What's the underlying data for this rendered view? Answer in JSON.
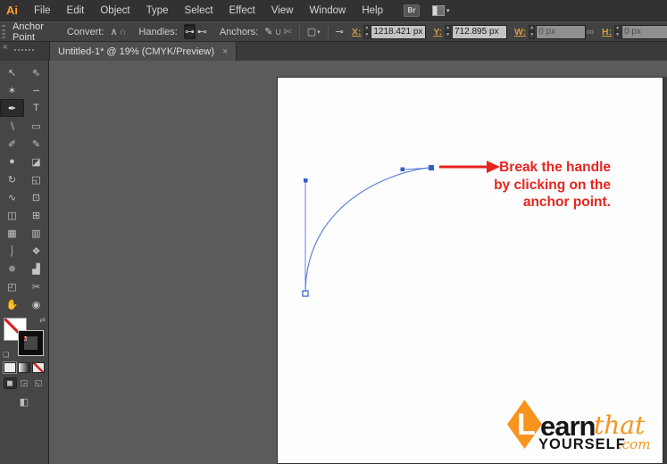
{
  "menubar": {
    "app_logo": "Ai",
    "items": [
      "File",
      "Edit",
      "Object",
      "Type",
      "Select",
      "Effect",
      "View",
      "Window",
      "Help"
    ],
    "bridge_icon": "Br",
    "workspace_caret": "▾"
  },
  "control_bar": {
    "context_label": "Anchor Point",
    "convert": {
      "label": "Convert:",
      "corner_icon": "∧",
      "smooth_icon": "∩"
    },
    "handles": {
      "label": "Handles:",
      "show_icon": "⊶",
      "hide_icon": "⊷"
    },
    "anchors": {
      "label": "Anchors:",
      "remove_icon": "✎",
      "connect_icon": "∪",
      "cut_icon": "✄"
    },
    "marquee_icon": "▢",
    "marquee_caret": "▾",
    "isolate_icon": "⊸",
    "x": {
      "label": "X:",
      "value": "1218.421 px"
    },
    "y": {
      "label": "Y:",
      "value": "712.895 px"
    },
    "w": {
      "label": "W:",
      "value": "0 px"
    },
    "h": {
      "label": "H:",
      "value": "0 px"
    },
    "link_icon": "∞",
    "transform_icon": "⊞",
    "stepper_up": "▲",
    "stepper_down": "▼"
  },
  "tab": {
    "title": "Untitled-1* @ 19% (CMYK/Preview)",
    "close": "×",
    "collapse": "«"
  },
  "toolbar": {
    "tools": [
      {
        "name": "selection",
        "glyph": "↖"
      },
      {
        "name": "direct-selection",
        "glyph": "⇖"
      },
      {
        "name": "magic-wand",
        "glyph": "✶"
      },
      {
        "name": "lasso",
        "glyph": "∽"
      },
      {
        "name": "pen",
        "glyph": "✒",
        "selected": true
      },
      {
        "name": "type",
        "glyph": "T"
      },
      {
        "name": "line-segment",
        "glyph": "∖"
      },
      {
        "name": "rectangle",
        "glyph": "▭"
      },
      {
        "name": "paintbrush",
        "glyph": "✐"
      },
      {
        "name": "pencil",
        "glyph": "✎"
      },
      {
        "name": "blob-brush",
        "glyph": "●"
      },
      {
        "name": "eraser",
        "glyph": "◪"
      },
      {
        "name": "rotate",
        "glyph": "↻"
      },
      {
        "name": "scale",
        "glyph": "◱"
      },
      {
        "name": "width",
        "glyph": "∿"
      },
      {
        "name": "free-transform",
        "glyph": "⊡"
      },
      {
        "name": "shape-builder",
        "glyph": "◫"
      },
      {
        "name": "perspective-grid",
        "glyph": "⊞"
      },
      {
        "name": "mesh",
        "glyph": "▦"
      },
      {
        "name": "gradient",
        "glyph": "▥"
      },
      {
        "name": "eyedropper",
        "glyph": "⌡"
      },
      {
        "name": "blend",
        "glyph": "❖"
      },
      {
        "name": "symbol-sprayer",
        "glyph": "✵"
      },
      {
        "name": "column-graph",
        "glyph": "▟"
      },
      {
        "name": "artboard",
        "glyph": "◰"
      },
      {
        "name": "slice",
        "glyph": "✂"
      },
      {
        "name": "hand",
        "glyph": "✋"
      },
      {
        "name": "zoom",
        "glyph": "◉"
      }
    ],
    "swap_icon": "⇄",
    "default_swatch_icon": "❏",
    "mode_icons": [
      "◼",
      "◲",
      "◱"
    ],
    "screen_mode_icon": "◧"
  },
  "annotation": {
    "lines": [
      "Break the handle",
      "by clicking on the",
      "anchor point."
    ],
    "color": "#e8241f"
  },
  "logo": {
    "l": "L",
    "earn": "earn",
    "that": "that",
    "yourself": "YOURSELF",
    "com": ".com",
    "orange": "#f7941d"
  },
  "colors": {
    "accent_orange": "#d29a43",
    "selection_blue": "#5f82d9",
    "anchor_blue": "#2e5fd0",
    "annotation_red": "#e8241f",
    "canvas_gray": "#5b5b5d",
    "panel_gray": "#464646"
  }
}
